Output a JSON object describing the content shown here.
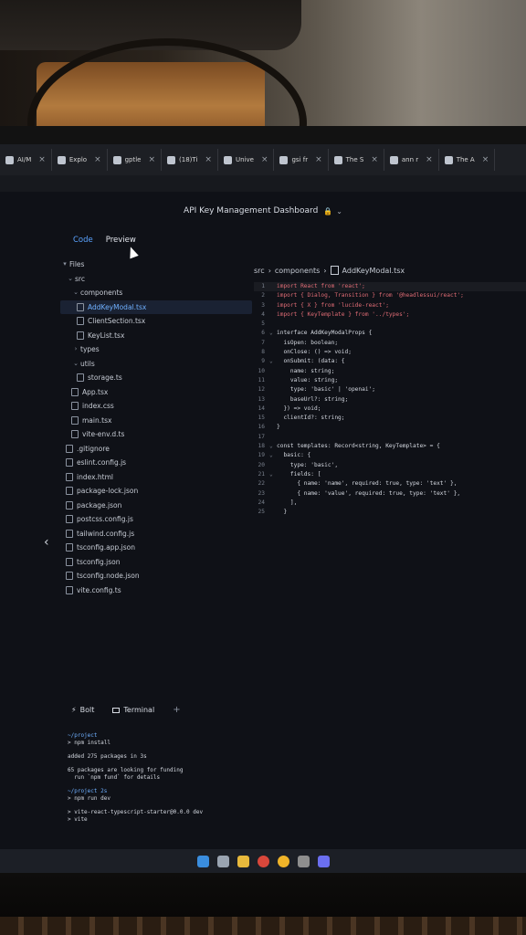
{
  "browser": {
    "tabs": [
      {
        "label": "AI/M"
      },
      {
        "label": "Explo"
      },
      {
        "label": "gptle"
      },
      {
        "label": "(18)Ti"
      },
      {
        "label": "Unive"
      },
      {
        "label": "gsi fr"
      },
      {
        "label": "The S"
      },
      {
        "label": "ann r"
      },
      {
        "label": "The A"
      }
    ]
  },
  "app": {
    "title": "API Key Management Dashboard",
    "tabs": {
      "code": "Code",
      "preview": "Preview"
    }
  },
  "sidebar": {
    "header": "Files",
    "nodes": [
      {
        "label": "src",
        "kind": "folder"
      },
      {
        "label": "components",
        "kind": "folder"
      },
      {
        "label": "AddKeyModal.tsx",
        "kind": "file",
        "active": true
      },
      {
        "label": "ClientSection.tsx",
        "kind": "file"
      },
      {
        "label": "KeyList.tsx",
        "kind": "file"
      },
      {
        "label": "types",
        "kind": "folder"
      },
      {
        "label": "utils",
        "kind": "folder"
      },
      {
        "label": "storage.ts",
        "kind": "file"
      },
      {
        "label": "App.tsx",
        "kind": "file"
      },
      {
        "label": "index.css",
        "kind": "file"
      },
      {
        "label": "main.tsx",
        "kind": "file"
      },
      {
        "label": "vite-env.d.ts",
        "kind": "file"
      },
      {
        "label": ".gitignore",
        "kind": "file"
      },
      {
        "label": "eslint.config.js",
        "kind": "file"
      },
      {
        "label": "index.html",
        "kind": "file"
      },
      {
        "label": "package-lock.json",
        "kind": "file"
      },
      {
        "label": "package.json",
        "kind": "file"
      },
      {
        "label": "postcss.config.js",
        "kind": "file"
      },
      {
        "label": "tailwind.config.js",
        "kind": "file"
      },
      {
        "label": "tsconfig.app.json",
        "kind": "file"
      },
      {
        "label": "tsconfig.json",
        "kind": "file"
      },
      {
        "label": "tsconfig.node.json",
        "kind": "file"
      },
      {
        "label": "vite.config.ts",
        "kind": "file"
      }
    ]
  },
  "editor": {
    "breadcrumb": {
      "root": "src",
      "folder": "components",
      "file": "AddKeyModal.tsx"
    },
    "lines": [
      {
        "n": "1",
        "text": "import React from 'react';"
      },
      {
        "n": "2",
        "text": "import { Dialog, Transition } from '@headlessui/react';"
      },
      {
        "n": "3",
        "text": "import { X } from 'lucide-react';"
      },
      {
        "n": "4",
        "text": "import { KeyTemplate } from '../types';"
      },
      {
        "n": "5",
        "text": ""
      },
      {
        "n": "6",
        "text": "interface AddKeyModalProps {"
      },
      {
        "n": "7",
        "text": "  isOpen: boolean;"
      },
      {
        "n": "8",
        "text": "  onClose: () => void;"
      },
      {
        "n": "9",
        "text": "  onSubmit: (data: {"
      },
      {
        "n": "10",
        "text": "    name: string;"
      },
      {
        "n": "11",
        "text": "    value: string;"
      },
      {
        "n": "12",
        "text": "    type: 'basic' | 'openai';"
      },
      {
        "n": "13",
        "text": "    baseUrl?: string;"
      },
      {
        "n": "14",
        "text": "  }) => void;"
      },
      {
        "n": "15",
        "text": "  clientId?: string;"
      },
      {
        "n": "16",
        "text": "}"
      },
      {
        "n": "17",
        "text": ""
      },
      {
        "n": "18",
        "text": "const templates: Record<string, KeyTemplate> = {"
      },
      {
        "n": "19",
        "text": "  basic: {"
      },
      {
        "n": "20",
        "text": "    type: 'basic',"
      },
      {
        "n": "21",
        "text": "    fields: ["
      },
      {
        "n": "22",
        "text": "      { name: 'name', required: true, type: 'text' },"
      },
      {
        "n": "23",
        "text": "      { name: 'value', required: true, type: 'text' },"
      },
      {
        "n": "24",
        "text": "    ],"
      },
      {
        "n": "25",
        "text": "  }"
      }
    ]
  },
  "panel": {
    "tabs": {
      "bolt": "Bolt",
      "terminal": "Terminal"
    },
    "terminal_lines": [
      {
        "text": "~/project",
        "kind": "path"
      },
      {
        "text": "> npm install",
        "kind": "cmd"
      },
      {
        "text": "",
        "kind": "gap"
      },
      {
        "text": "added 275 packages in 3s",
        "kind": "out"
      },
      {
        "text": "",
        "kind": "gap"
      },
      {
        "text": "65 packages are looking for funding",
        "kind": "out"
      },
      {
        "text": "  run `npm fund` for details",
        "kind": "out"
      },
      {
        "text": "",
        "kind": "gap"
      },
      {
        "text": "~/project 2s",
        "kind": "path"
      },
      {
        "text": "> npm run dev",
        "kind": "cmd"
      },
      {
        "text": "",
        "kind": "gap"
      },
      {
        "text": "> vite-react-typescript-starter@0.0.0 dev",
        "kind": "out"
      },
      {
        "text": "> vite",
        "kind": "out"
      }
    ]
  },
  "taskbar": {
    "icons": [
      {
        "name": "windows-start-icon",
        "color": "#3a8dde"
      },
      {
        "name": "settings-icon",
        "color": "#9aa4b1"
      },
      {
        "name": "folder-icon",
        "color": "#e8b93c"
      },
      {
        "name": "chrome-icon",
        "color": "#d9473b"
      },
      {
        "name": "browser-icon",
        "color": "#f0b429"
      },
      {
        "name": "app-icon",
        "color": "#8e8e8e"
      },
      {
        "name": "discord-icon",
        "color": "#6b6ff0"
      }
    ]
  }
}
